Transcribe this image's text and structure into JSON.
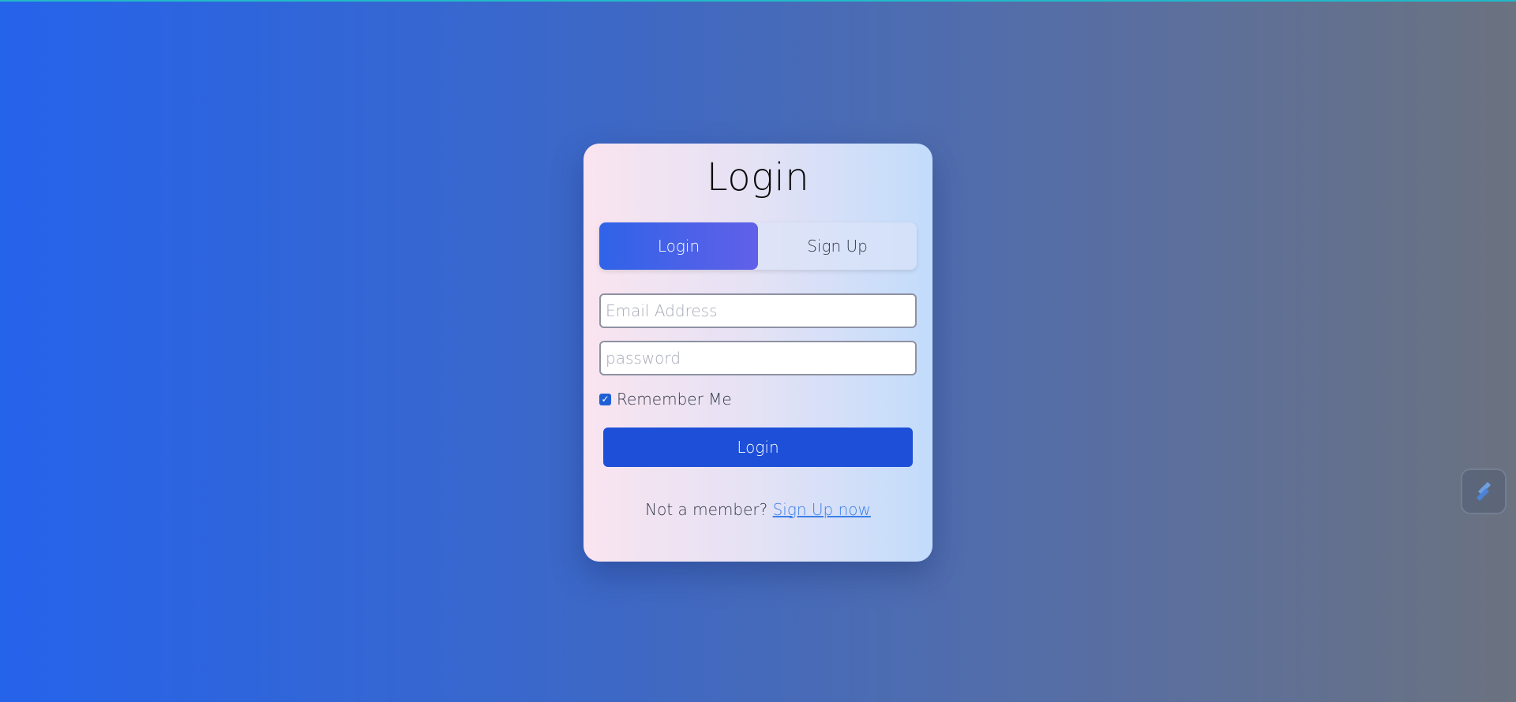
{
  "card": {
    "title": "Login"
  },
  "tabs": {
    "login": "Login",
    "signup": "Sign Up"
  },
  "form": {
    "email_placeholder": "Email Address",
    "email_value": "",
    "password_placeholder": "password",
    "password_value": "",
    "remember_label": "Remember Me",
    "remember_checked": true,
    "submit_label": "Login"
  },
  "footer": {
    "prompt": "Not a member? ",
    "link": "Sign Up now"
  },
  "icons": {
    "widget": "stack-icon"
  },
  "colors": {
    "primary": "#1d4fd8",
    "tab_active_start": "#2f63e8",
    "tab_active_end": "#6160e8",
    "link": "#3b7fe8"
  }
}
